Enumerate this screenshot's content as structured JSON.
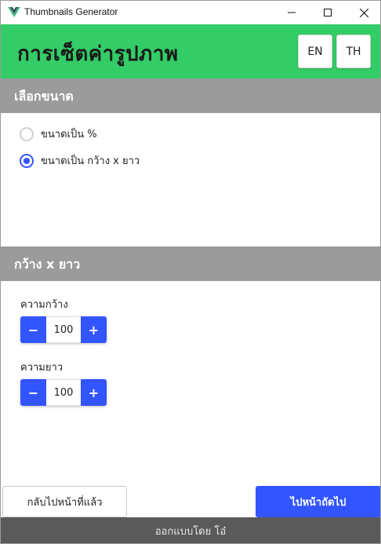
{
  "window": {
    "title": "Thumbnails Generator",
    "icons": {
      "logo": "vue-logo",
      "minimize": "minimize-icon",
      "maximize": "maximize-icon",
      "close": "close-icon"
    }
  },
  "header": {
    "title": "การเซ็ตค่ารูปภาพ",
    "lang_en": "EN",
    "lang_th": "TH",
    "color": "#33cc66"
  },
  "size_section": {
    "heading": "เลือกขนาด",
    "options": [
      {
        "label": "ขนาดเป็น %",
        "selected": false
      },
      {
        "label": "ขนาดเป็น กว้าง x ยาว",
        "selected": true
      }
    ]
  },
  "dimensions_section": {
    "heading": "กว้าง x ยาว",
    "width": {
      "label": "ความกว้าง",
      "value": "100",
      "minus": "−",
      "plus": "+"
    },
    "height": {
      "label": "ความยาว",
      "value": "100",
      "minus": "−",
      "plus": "+"
    }
  },
  "actions": {
    "back": "กลับไปหน้าที่แล้ว",
    "next": "ไปหน้าถัดไป",
    "accent": "#3355ff"
  },
  "footer": {
    "text": "ออกแบบโดย โอ๋"
  }
}
